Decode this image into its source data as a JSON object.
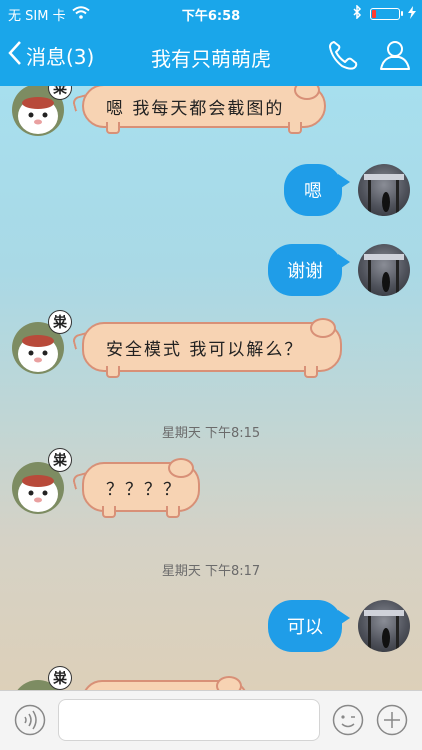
{
  "status_bar": {
    "carrier": "无 SIM 卡",
    "time": "下午6:58",
    "battery_level": 0.15,
    "icons": [
      "wifi-icon",
      "bluetooth-icon",
      "battery-icon",
      "charging-icon"
    ]
  },
  "nav": {
    "back_label": "消息(3)",
    "title": "我有只萌萌虎",
    "right_icons": [
      "phone-icon",
      "profile-icon"
    ]
  },
  "colors": {
    "nav_bg": "#1aa6ea",
    "sent_bubble": "#1f9de8",
    "received_bubble": "#f7d3b3",
    "received_border": "#d89077"
  },
  "contact_badge_glyph": "粜",
  "messages": [
    {
      "side": "left",
      "text": "嗯  我每天都会截图的"
    },
    {
      "side": "right",
      "text": "嗯"
    },
    {
      "side": "right",
      "text": "谢谢"
    },
    {
      "side": "left",
      "text": "安全模式  我可以解么？"
    },
    {
      "side": "time",
      "text": "星期天 下午8:15"
    },
    {
      "side": "left",
      "text": "？？？？"
    },
    {
      "side": "time",
      "text": "星期天 下午8:17"
    },
    {
      "side": "right",
      "text": "可以"
    },
    {
      "side": "left",
      "text": ""
    }
  ],
  "input_bar": {
    "placeholder": "",
    "left_icon": "voice-icon",
    "right_icons": [
      "emoji-icon",
      "add-icon"
    ]
  }
}
